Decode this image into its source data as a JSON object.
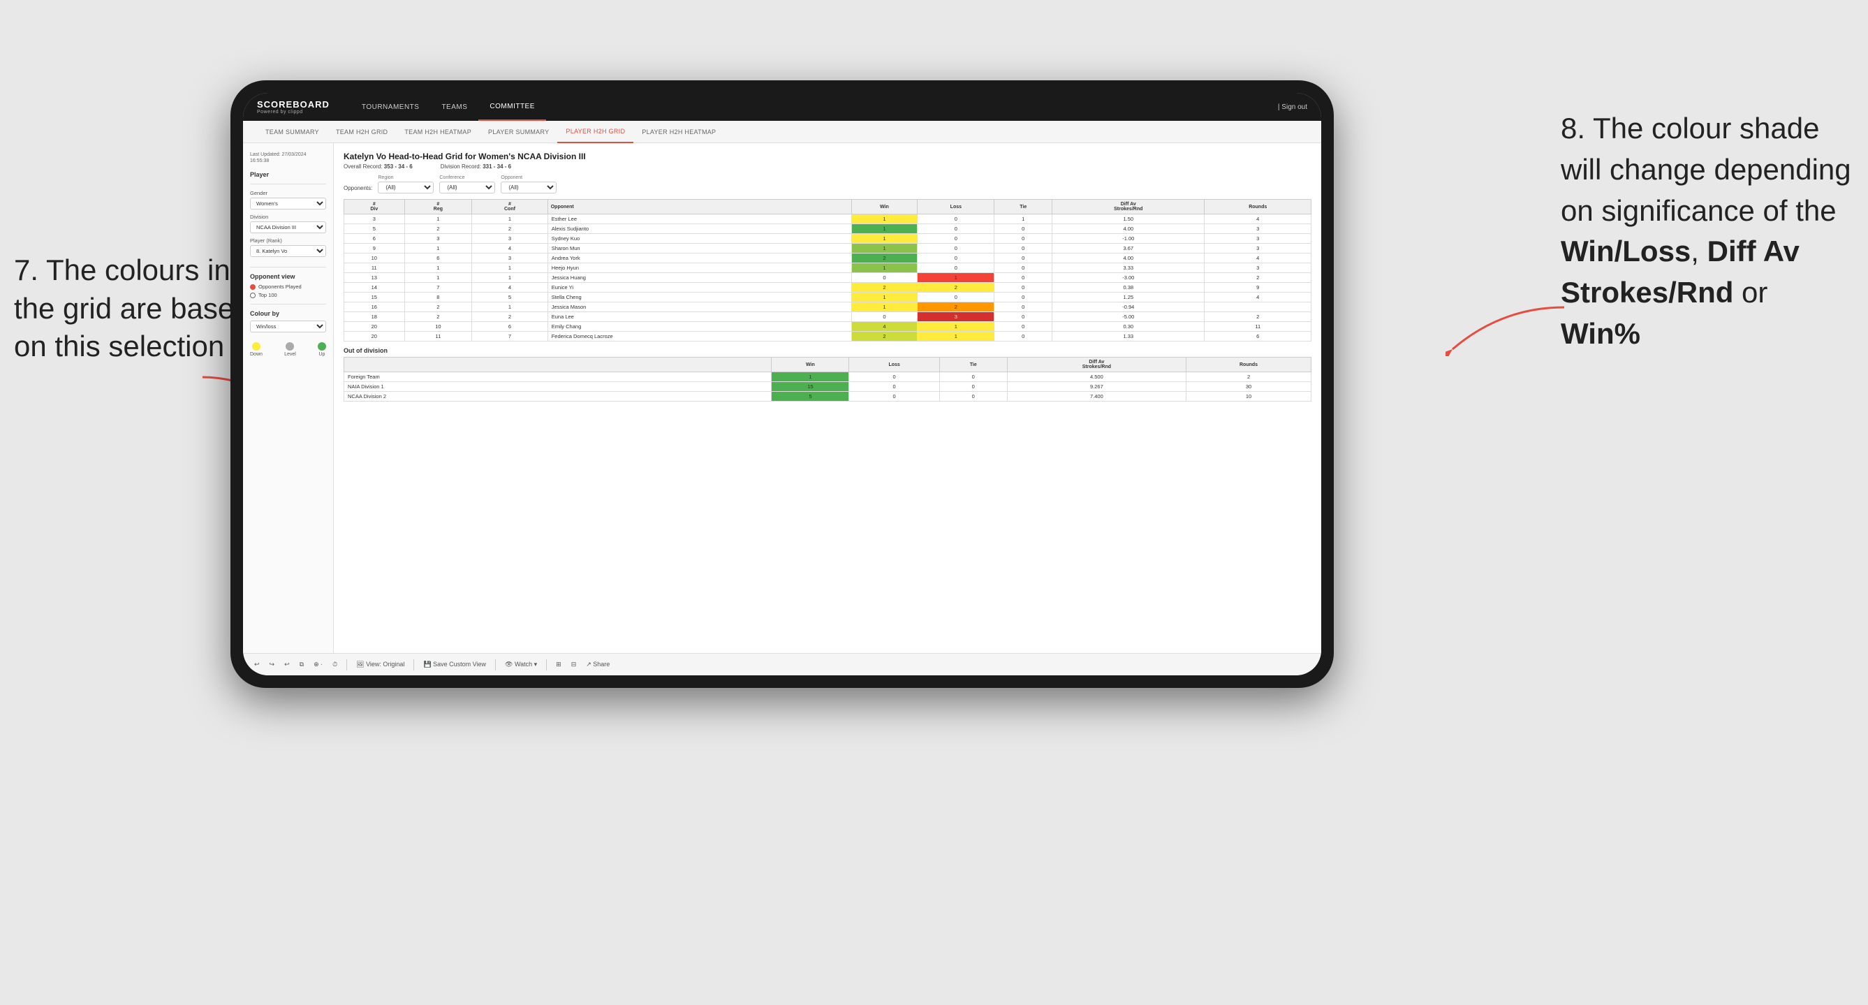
{
  "annotations": {
    "left": {
      "line1": "7. The colours in",
      "line2": "the grid are based",
      "line3": "on this selection"
    },
    "right": {
      "intro": "8. The colour shade will change depending on significance of the ",
      "bold1": "Win/Loss",
      "sep1": ", ",
      "bold2": "Diff Av Strokes/Rnd",
      "sep2": " or ",
      "bold3": "Win%"
    }
  },
  "nav": {
    "logo": "SCOREBOARD",
    "logo_sub": "Powered by clippd",
    "items": [
      "TOURNAMENTS",
      "TEAMS",
      "COMMITTEE"
    ],
    "active": "COMMITTEE",
    "sign_in": "Sign out"
  },
  "sub_nav": {
    "items": [
      "TEAM SUMMARY",
      "TEAM H2H GRID",
      "TEAM H2H HEATMAP",
      "PLAYER SUMMARY",
      "PLAYER H2H GRID",
      "PLAYER H2H HEATMAP"
    ],
    "active": "PLAYER H2H GRID"
  },
  "sidebar": {
    "last_updated_label": "Last Updated: 27/03/2024",
    "last_updated_time": "16:55:38",
    "player_section": "Player",
    "gender_label": "Gender",
    "gender_value": "Women's",
    "division_label": "Division",
    "division_value": "NCAA Division III",
    "player_rank_label": "Player (Rank)",
    "player_rank_value": "8. Katelyn Vo",
    "opponent_view_label": "Opponent view",
    "radio1": "Opponents Played",
    "radio2": "Top 100",
    "colour_by_label": "Colour by",
    "colour_by_value": "Win/loss",
    "legend": {
      "down": "Down",
      "level": "Level",
      "up": "Up"
    }
  },
  "grid": {
    "title": "Katelyn Vo Head-to-Head Grid for Women's NCAA Division III",
    "overall_record_label": "Overall Record:",
    "overall_record": "353 - 34 - 6",
    "division_record_label": "Division Record:",
    "division_record": "331 - 34 - 6",
    "opponents_label": "Opponents:",
    "region_label": "Region",
    "conference_label": "Conference",
    "opponent_label": "Opponent",
    "filter_all": "(All)",
    "columns": {
      "div": "#\nDiv",
      "reg": "#\nReg",
      "conf": "#\nConf",
      "opponent": "Opponent",
      "win": "Win",
      "loss": "Loss",
      "tie": "Tie",
      "diff_av": "Diff Av\nStrokes/Rnd",
      "rounds": "Rounds"
    },
    "rows": [
      {
        "div": 3,
        "reg": 1,
        "conf": 1,
        "opponent": "Esther Lee",
        "win": 1,
        "loss": 0,
        "tie": 1,
        "diff": 1.5,
        "rounds": 4,
        "win_color": "yellow",
        "loss_color": "white"
      },
      {
        "div": 5,
        "reg": 2,
        "conf": 2,
        "opponent": "Alexis Sudjianto",
        "win": 1,
        "loss": 0,
        "tie": 0,
        "diff": 4.0,
        "rounds": 3,
        "win_color": "green-dark",
        "loss_color": "white"
      },
      {
        "div": 6,
        "reg": 3,
        "conf": 3,
        "opponent": "Sydney Kuo",
        "win": 1,
        "loss": 0,
        "tie": 0,
        "diff": -1.0,
        "rounds": 3,
        "win_color": "yellow",
        "loss_color": "white"
      },
      {
        "div": 9,
        "reg": 1,
        "conf": 4,
        "opponent": "Sharon Mun",
        "win": 1,
        "loss": 0,
        "tie": 0,
        "diff": 3.67,
        "rounds": 3,
        "win_color": "green-med",
        "loss_color": "white"
      },
      {
        "div": 10,
        "reg": 6,
        "conf": 3,
        "opponent": "Andrea York",
        "win": 2,
        "loss": 0,
        "tie": 0,
        "diff": 4.0,
        "rounds": 4,
        "win_color": "green-dark",
        "loss_color": "white"
      },
      {
        "div": 11,
        "reg": 1,
        "conf": 1,
        "opponent": "Heejo Hyun",
        "win": 1,
        "loss": 0,
        "tie": 0,
        "diff": 3.33,
        "rounds": 3,
        "win_color": "green-med",
        "loss_color": "white"
      },
      {
        "div": 13,
        "reg": 1,
        "conf": 1,
        "opponent": "Jessica Huang",
        "win": 0,
        "loss": 1,
        "tie": 0,
        "diff": -3.0,
        "rounds": 2,
        "win_color": "white",
        "loss_color": "red-med"
      },
      {
        "div": 14,
        "reg": 7,
        "conf": 4,
        "opponent": "Eunice Yi",
        "win": 2,
        "loss": 2,
        "tie": 0,
        "diff": 0.38,
        "rounds": 9,
        "win_color": "yellow",
        "loss_color": "yellow"
      },
      {
        "div": 15,
        "reg": 8,
        "conf": 5,
        "opponent": "Stella Cheng",
        "win": 1,
        "loss": 0,
        "tie": 0,
        "diff": 1.25,
        "rounds": 4,
        "win_color": "yellow",
        "loss_color": "white"
      },
      {
        "div": 16,
        "reg": 2,
        "conf": 1,
        "opponent": "Jessica Mason",
        "win": 1,
        "loss": 2,
        "tie": 0,
        "diff": -0.94,
        "rounds": "",
        "win_color": "yellow",
        "loss_color": "red-light"
      },
      {
        "div": 18,
        "reg": 2,
        "conf": 2,
        "opponent": "Euna Lee",
        "win": 0,
        "loss": 3,
        "tie": 0,
        "diff": -5.0,
        "rounds": 2,
        "win_color": "white",
        "loss_color": "red-dark"
      },
      {
        "div": 20,
        "reg": 10,
        "conf": 6,
        "opponent": "Emily Chang",
        "win": 4,
        "loss": 1,
        "tie": 0,
        "diff": 0.3,
        "rounds": 11,
        "win_color": "green-light",
        "loss_color": "yellow"
      },
      {
        "div": 20,
        "reg": 11,
        "conf": 7,
        "opponent": "Federica Domecq Lacroze",
        "win": 2,
        "loss": 1,
        "tie": 0,
        "diff": 1.33,
        "rounds": 6,
        "win_color": "green-light",
        "loss_color": "yellow"
      }
    ],
    "out_of_division_label": "Out of division",
    "out_of_division_rows": [
      {
        "team": "Foreign Team",
        "win": 1,
        "loss": 0,
        "tie": 0,
        "diff": 4.5,
        "rounds": 2,
        "win_color": "green-dark"
      },
      {
        "team": "NAIA Division 1",
        "win": 15,
        "loss": 0,
        "tie": 0,
        "diff": 9.267,
        "rounds": 30,
        "win_color": "green-dark"
      },
      {
        "team": "NCAA Division 2",
        "win": 5,
        "loss": 0,
        "tie": 0,
        "diff": 7.4,
        "rounds": 10,
        "win_color": "green-dark"
      }
    ]
  },
  "toolbar": {
    "view_original": "View: Original",
    "save_custom": "Save Custom View",
    "watch": "Watch",
    "share": "Share"
  }
}
